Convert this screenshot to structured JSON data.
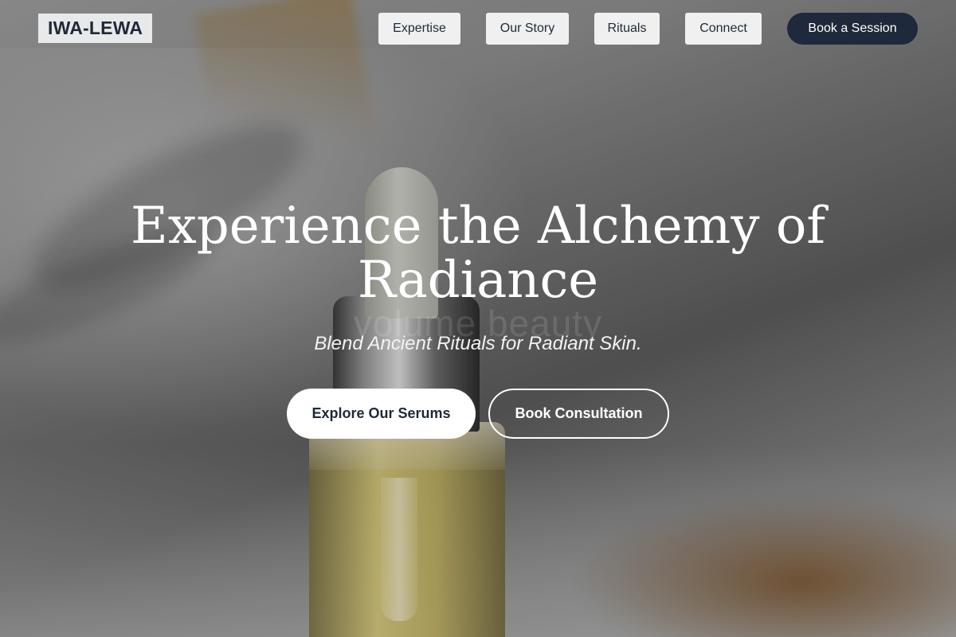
{
  "header": {
    "logo": "IWA-LEWA",
    "nav": [
      {
        "label": "Expertise"
      },
      {
        "label": "Our Story"
      },
      {
        "label": "Rituals"
      },
      {
        "label": "Connect"
      }
    ],
    "cta_label": "Book a Session"
  },
  "hero": {
    "title": "Experience the Alchemy of Radiance",
    "ghost_text": "volume beauty",
    "subtitle": "Blend Ancient Rituals for Radiant Skin.",
    "primary_button": "Explore Our Serums",
    "secondary_button": "Book Consultation"
  },
  "colors": {
    "cta_background": "#1e293b",
    "text_dark": "#1f2937",
    "nav_background": "#f0f0f0"
  }
}
